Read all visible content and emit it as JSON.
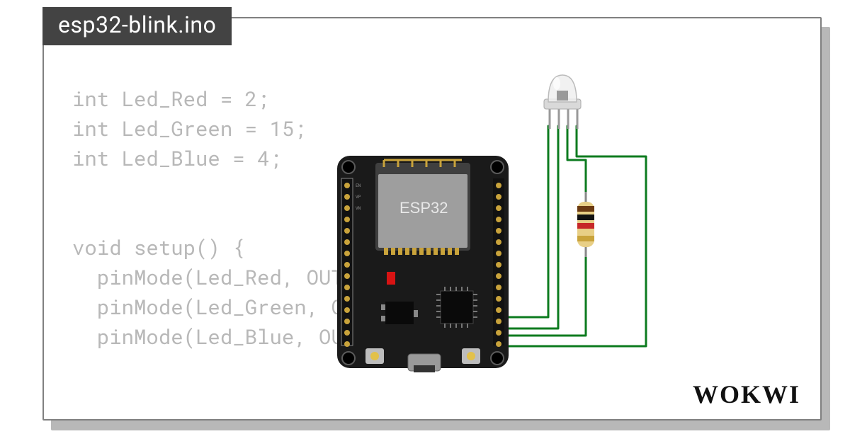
{
  "tab": {
    "title": "esp32-blink.ino"
  },
  "code": {
    "lines": [
      "int Led_Red = 2;",
      "int Led_Green = 15;",
      "int Led_Blue = 4;",
      "",
      "",
      "void setup() {",
      "  pinMode(Led_Red, OUTPUT);",
      "  pinMode(Led_Green, OUTPUT);",
      "  pinMode(Led_Blue, OUTPUT);"
    ]
  },
  "board": {
    "label": "ESP32"
  },
  "brand": "WOKWI",
  "components": {
    "mcu": "esp32-devkit",
    "led": "rgb-led",
    "resistor": "resistor"
  },
  "wire_color": "#0c7b1f"
}
